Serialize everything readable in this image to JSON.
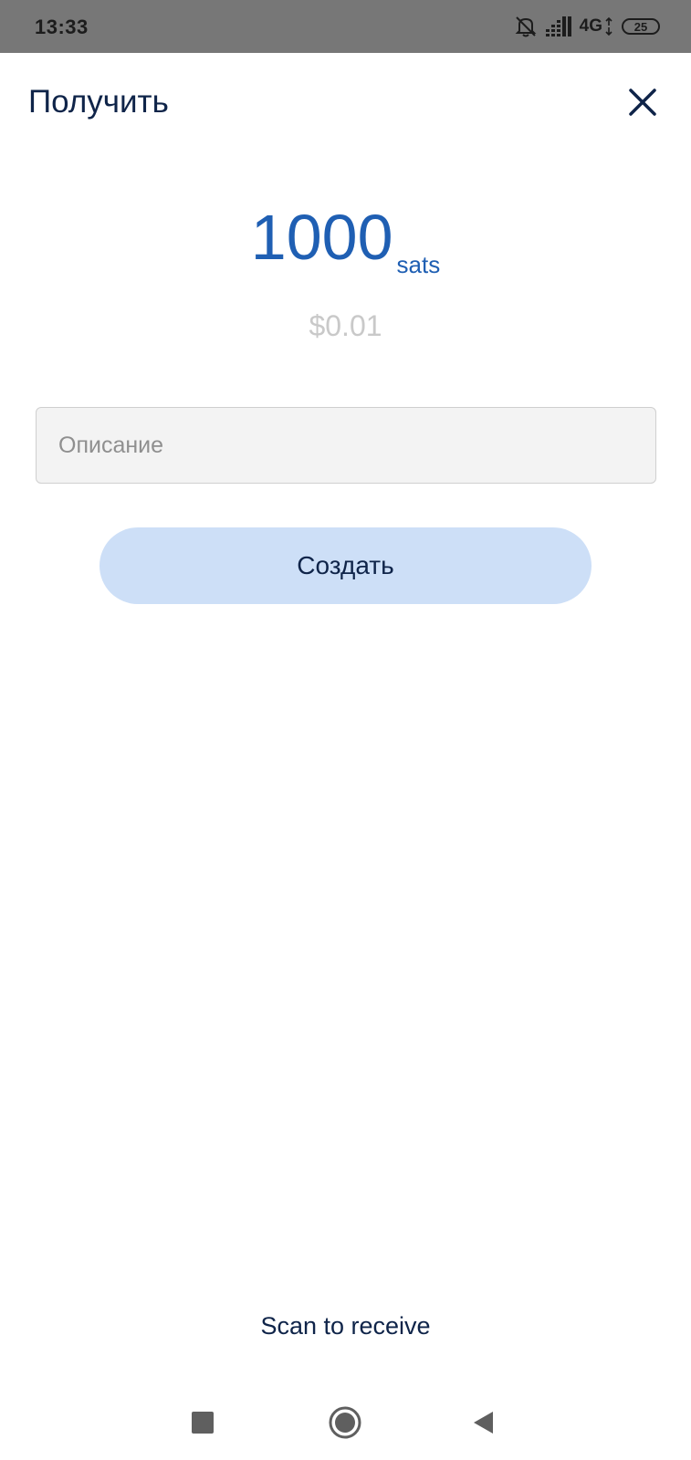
{
  "status_bar": {
    "time": "13:33",
    "network_type": "4G",
    "battery": "25",
    "icons": [
      "bell-muted-icon",
      "signal-icon",
      "battery-icon"
    ]
  },
  "header": {
    "title": "Получить",
    "close_icon": "close-icon"
  },
  "amount": {
    "value": "1000",
    "unit": "sats",
    "fiat": "$0.01"
  },
  "description": {
    "value": "",
    "placeholder": "Описание"
  },
  "actions": {
    "create_label": "Создать",
    "scan_label": "Scan to receive"
  },
  "nav_bar": {
    "icons": [
      "recents-square-icon",
      "home-circle-icon",
      "back-triangle-icon"
    ]
  },
  "colors": {
    "accent": "#1f5fb3",
    "title": "#0f2449",
    "button_bg": "#cddff7",
    "status_bar_bg": "#777777",
    "fiat_muted": "#c9c9c9"
  }
}
